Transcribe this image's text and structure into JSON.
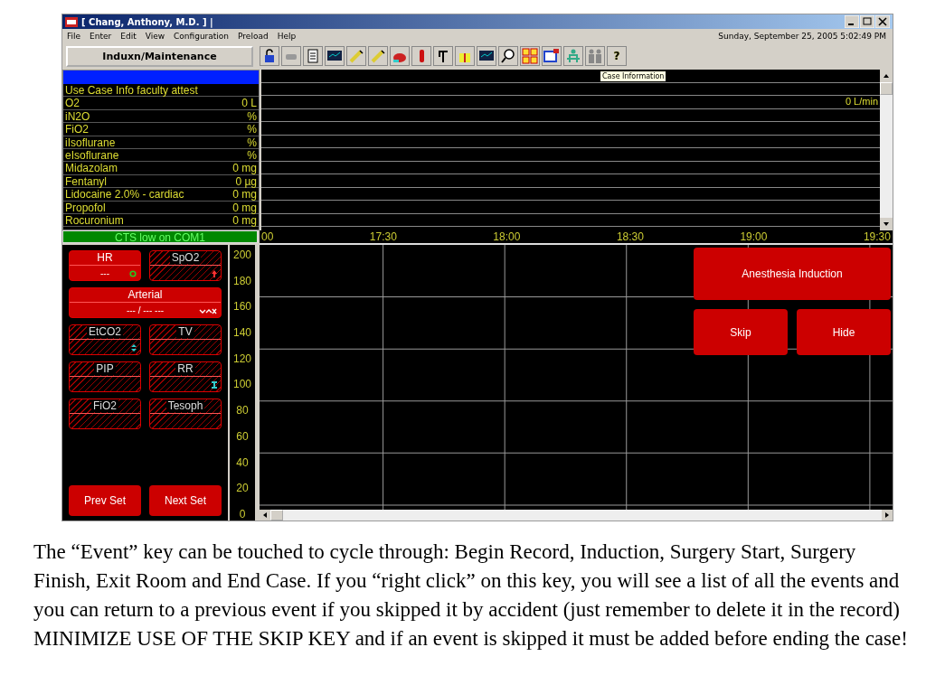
{
  "window": {
    "title": "[ Chang, Anthony, M.D. ] |",
    "datetime": "Sunday, September 25, 2005 5:02:49 PM"
  },
  "menu": [
    "File",
    "Enter",
    "Edit",
    "View",
    "Configuration",
    "Preload",
    "Help"
  ],
  "toolbar": {
    "mode_button": "Induxn/Maintenance",
    "help_label": "?",
    "tooltip": "Case Information"
  },
  "drugs": [
    {
      "name": "Use Case Info faculty attest"
    },
    {
      "name": "O2",
      "value": "0 L",
      "trend_value": "0 L/min"
    },
    {
      "name": "iN2O",
      "value": "%"
    },
    {
      "name": "FiO2",
      "value": "%"
    },
    {
      "name": "iIsoflurane",
      "value": "%"
    },
    {
      "name": "eIsoflurane",
      "value": "%"
    },
    {
      "name": "Midazolam",
      "value": "0 mg"
    },
    {
      "name": "Fentanyl",
      "value": "0 µg"
    },
    {
      "name": "Lidocaine 2.0% - cardiac",
      "value": "0 mg"
    },
    {
      "name": "Propofol",
      "value": "0 mg"
    },
    {
      "name": "Rocuronium",
      "value": "0 mg"
    }
  ],
  "status": "CTS low on COM1",
  "vitals": [
    {
      "label": "HR",
      "value": "---",
      "active": true,
      "kind": "single"
    },
    {
      "label": "SpO2",
      "active": false,
      "kind": "single"
    },
    {
      "label": "Arterial",
      "value": "--- / ---  ---",
      "active": true,
      "kind": "wide"
    },
    {
      "label": "EtCO2",
      "active": false,
      "kind": "single"
    },
    {
      "label": "TV",
      "active": false,
      "kind": "single"
    },
    {
      "label": "PIP",
      "active": false,
      "kind": "single"
    },
    {
      "label": "RR",
      "active": false,
      "kind": "single"
    },
    {
      "label": "FiO2",
      "active": false,
      "kind": "single"
    },
    {
      "label": "Tesoph",
      "active": false,
      "kind": "single"
    }
  ],
  "set_buttons": [
    "Prev Set",
    "Next Set"
  ],
  "y_scale": [
    "200",
    "180",
    "160",
    "140",
    "120",
    "100",
    "80",
    "60",
    "40",
    "20",
    "0"
  ],
  "time_axis": [
    "00",
    "17:30",
    "18:00",
    "18:30",
    "19:00",
    "19:30"
  ],
  "event_buttons": [
    "Anesthesia Induction",
    "Skip",
    "Hide"
  ],
  "caption": "The “Event” key can be touched to cycle through: Begin Record, Induction, Surgery Start, Surgery Finish, Exit Room and End Case.  If you “right click” on this key, you will see a list of all the events and you can return to a previous event if you skipped it by accident (just remember to delete it in the record) MINIMIZE USE OF THE SKIP KEY and if an event is skipped it must be added before ending the case!"
}
